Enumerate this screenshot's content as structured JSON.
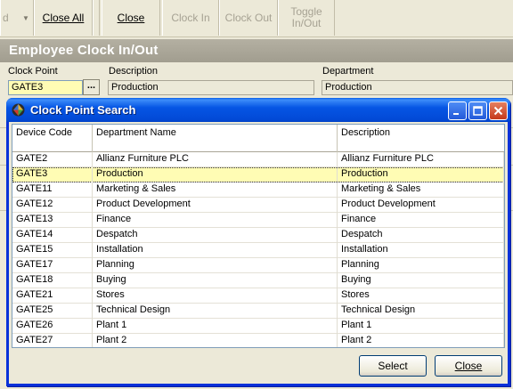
{
  "toolbar": {
    "partial_label": "d",
    "close_all_label": "Close All",
    "close_label": "Close",
    "clock_in_label": "Clock In",
    "clock_out_label": "Clock Out",
    "toggle_label_line1": "Toggle",
    "toggle_label_line2": "In/Out"
  },
  "form": {
    "title": "Employee Clock In/Out",
    "clock_point_label": "Clock Point",
    "clock_point_value": "GATE3",
    "ellipsis_label": "...",
    "description_label": "Description",
    "description_value": "Production",
    "department_label": "Department",
    "department_value": "Production"
  },
  "dialog": {
    "title": "Clock Point Search",
    "columns": [
      "Device Code",
      "Department Name",
      "Description"
    ],
    "rows": [
      {
        "code": "GATE2",
        "dept": "Allianz Furniture PLC",
        "desc": "Allianz Furniture PLC"
      },
      {
        "code": "GATE3",
        "dept": "Production",
        "desc": "Production"
      },
      {
        "code": "GATE11",
        "dept": "Marketing & Sales",
        "desc": "Marketing & Sales"
      },
      {
        "code": "GATE12",
        "dept": "Product Development",
        "desc": "Product Development"
      },
      {
        "code": "GATE13",
        "dept": "Finance",
        "desc": "Finance"
      },
      {
        "code": "GATE14",
        "dept": "Despatch",
        "desc": "Despatch"
      },
      {
        "code": "GATE15",
        "dept": "Installation",
        "desc": "Installation"
      },
      {
        "code": "GATE17",
        "dept": "Planning",
        "desc": "Planning"
      },
      {
        "code": "GATE18",
        "dept": "Buying",
        "desc": "Buying"
      },
      {
        "code": "GATE21",
        "dept": "Stores",
        "desc": "Stores"
      },
      {
        "code": "GATE25",
        "dept": "Technical Design",
        "desc": "Technical Design"
      },
      {
        "code": "GATE26",
        "dept": "Plant 1",
        "desc": "Plant 1"
      },
      {
        "code": "GATE27",
        "dept": "Plant 2",
        "desc": "Plant 2"
      }
    ],
    "selected_row": 1,
    "select_label": "Select",
    "close_label": "Close"
  }
}
